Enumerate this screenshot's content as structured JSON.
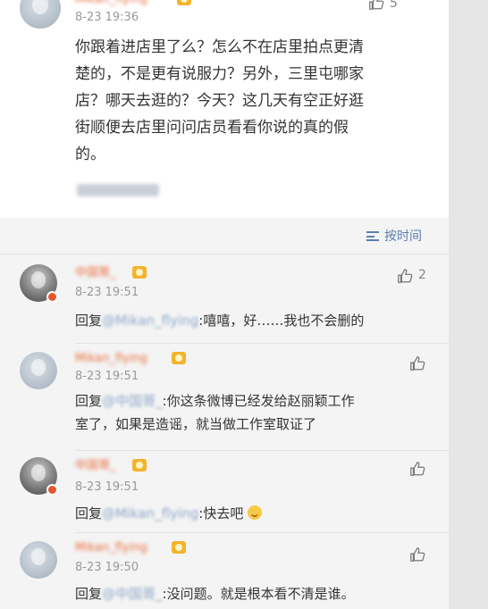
{
  "post": {
    "username": "Mikan_flying",
    "time": "8-23 19:36",
    "like_count": "5",
    "text_lines": [
      "你跟着进店里了么？怎么不在店里拍点更清",
      "楚的，不是更有说服力？另外，三里屯哪家",
      "店？哪天去逛的？今天？这几天有空正好逛",
      "街顺便去店里问问店员看看你说的真的假",
      "的。"
    ]
  },
  "sort": {
    "label": "按时间"
  },
  "comments": [
    {
      "username": "中国哥_",
      "time": "8-23 19:51",
      "like_count": "2",
      "prefix": "回复",
      "mention": "@Mikan_flying",
      "body": ":嘻嘻，好……我也不会删的"
    },
    {
      "username": "Mikan_flying",
      "time": "8-23 19:51",
      "like_count": "",
      "prefix": "回复",
      "mention": "@中国哥_",
      "body": ":你这条微博已经发给赵丽颖工作",
      "body2": "室了，如果是造谣，就当做工作室取证了"
    },
    {
      "username": "中国哥_",
      "time": "8-23 19:51",
      "like_count": "",
      "prefix": "回复",
      "mention": "@Mikan_flying",
      "body": ":快去吧"
    },
    {
      "username": "Mikan_flying",
      "time": "8-23 19:50",
      "like_count": "",
      "prefix": "回复",
      "mention": "@中国哥_",
      "body": ":没问题。就是根本看不清是谁。"
    }
  ]
}
